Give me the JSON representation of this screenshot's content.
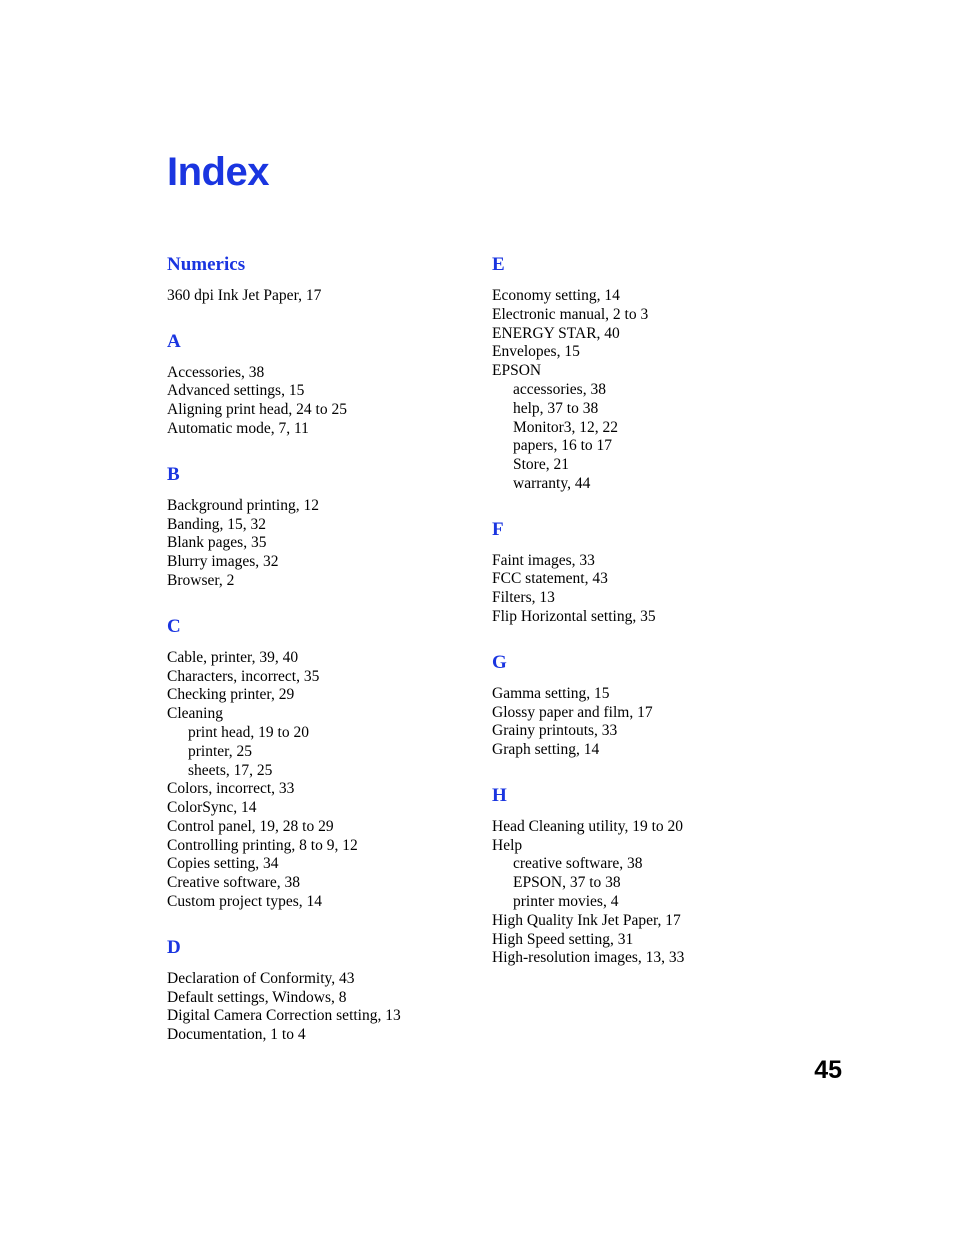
{
  "document": {
    "title": "Index",
    "page_number": "45",
    "heading_color": "#1a35e0",
    "body_color": "#000000"
  },
  "columns": {
    "left": [
      {
        "heading": "Numerics",
        "entries": [
          {
            "text": "360 dpi Ink Jet Paper, 17",
            "level": 0
          }
        ]
      },
      {
        "heading": "A",
        "entries": [
          {
            "text": "Accessories, 38",
            "level": 0
          },
          {
            "text": "Advanced settings, 15",
            "level": 0
          },
          {
            "text": "Aligning print head, 24 to 25",
            "level": 0
          },
          {
            "text": "Automatic mode, 7, 11",
            "level": 0
          }
        ]
      },
      {
        "heading": "B",
        "entries": [
          {
            "text": "Background printing, 12",
            "level": 0
          },
          {
            "text": "Banding, 15, 32",
            "level": 0
          },
          {
            "text": "Blank pages, 35",
            "level": 0
          },
          {
            "text": "Blurry images, 32",
            "level": 0
          },
          {
            "text": "Browser, 2",
            "level": 0
          }
        ]
      },
      {
        "heading": "C",
        "entries": [
          {
            "text": "Cable, printer, 39, 40",
            "level": 0
          },
          {
            "text": "Characters, incorrect, 35",
            "level": 0
          },
          {
            "text": "Checking printer, 29",
            "level": 0
          },
          {
            "text": "Cleaning",
            "level": 0
          },
          {
            "text": "print head, 19 to 20",
            "level": 1
          },
          {
            "text": "printer, 25",
            "level": 1
          },
          {
            "text": "sheets, 17, 25",
            "level": 1
          },
          {
            "text": "Colors, incorrect, 33",
            "level": 0
          },
          {
            "text": "ColorSync, 14",
            "level": 0
          },
          {
            "text": "Control panel, 19, 28 to 29",
            "level": 0
          },
          {
            "text": "Controlling printing, 8 to 9, 12",
            "level": 0
          },
          {
            "text": "Copies setting, 34",
            "level": 0
          },
          {
            "text": "Creative software, 38",
            "level": 0
          },
          {
            "text": "Custom project types, 14",
            "level": 0
          }
        ]
      },
      {
        "heading": "D",
        "entries": [
          {
            "text": "Declaration of Conformity, 43",
            "level": 0
          },
          {
            "text": "Default settings, Windows, 8",
            "level": 0
          },
          {
            "text": "Digital Camera Correction setting, 13",
            "level": 0
          },
          {
            "text": "Documentation, 1 to 4",
            "level": 0
          }
        ]
      }
    ],
    "right": [
      {
        "heading": "E",
        "entries": [
          {
            "text": "Economy setting, 14",
            "level": 0
          },
          {
            "text": "Electronic manual, 2 to 3",
            "level": 0
          },
          {
            "text": "ENERGY STAR, 40",
            "level": 0
          },
          {
            "text": "Envelopes, 15",
            "level": 0
          },
          {
            "text": "EPSON",
            "level": 0
          },
          {
            "text": "accessories, 38",
            "level": 1
          },
          {
            "text": "help, 37 to 38",
            "level": 1
          },
          {
            "text": "Monitor3, 12, 22",
            "level": 1
          },
          {
            "text": "papers, 16 to 17",
            "level": 1
          },
          {
            "text": "Store, 21",
            "level": 1
          },
          {
            "text": "warranty, 44",
            "level": 1
          }
        ]
      },
      {
        "heading": "F",
        "entries": [
          {
            "text": "Faint images, 33",
            "level": 0
          },
          {
            "text": "FCC statement, 43",
            "level": 0
          },
          {
            "text": "Filters, 13",
            "level": 0
          },
          {
            "text": "Flip Horizontal setting, 35",
            "level": 0
          }
        ]
      },
      {
        "heading": "G",
        "entries": [
          {
            "text": "Gamma setting, 15",
            "level": 0
          },
          {
            "text": "Glossy paper and film, 17",
            "level": 0
          },
          {
            "text": "Grainy printouts, 33",
            "level": 0
          },
          {
            "text": "Graph setting, 14",
            "level": 0
          }
        ]
      },
      {
        "heading": "H",
        "entries": [
          {
            "text": "Head Cleaning utility, 19 to 20",
            "level": 0
          },
          {
            "text": "Help",
            "level": 0
          },
          {
            "text": "creative software, 38",
            "level": 1
          },
          {
            "text": "EPSON, 37 to 38",
            "level": 1
          },
          {
            "text": "printer movies, 4",
            "level": 1
          },
          {
            "text": "High Quality Ink Jet Paper, 17",
            "level": 0
          },
          {
            "text": "High Speed setting, 31",
            "level": 0
          },
          {
            "text": "High-resolution images, 13, 33",
            "level": 0
          }
        ]
      }
    ]
  }
}
